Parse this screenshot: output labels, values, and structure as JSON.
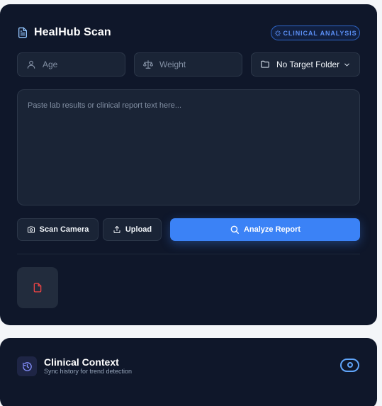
{
  "header": {
    "title": "HealHub Scan",
    "badge": "CLINICAL ANALYSIS"
  },
  "fields": {
    "age": {
      "placeholder": "Age",
      "value": ""
    },
    "weight": {
      "placeholder": "Weight",
      "value": ""
    },
    "folder": {
      "selected": "No Target Folder"
    }
  },
  "report": {
    "placeholder": "Paste lab results or clinical report text here...",
    "value": ""
  },
  "actions": {
    "camera": "Scan Camera",
    "upload": "Upload",
    "analyze": "Analyze Report"
  },
  "context": {
    "title": "Clinical Context",
    "subtitle": "Sync history for trend detection",
    "toggle_on": true
  },
  "icons": {
    "header": "file-text-icon",
    "badge": "sparkle-icon",
    "age": "user-icon",
    "weight": "scale-icon",
    "folder": "folder-icon",
    "folder_chevron": "chevron-down-icon",
    "camera": "camera-icon",
    "upload": "upload-icon",
    "analyze": "search-icon",
    "attachment": "file-icon",
    "context": "history-icon"
  },
  "colors": {
    "card_bg": "#0f172a",
    "accent": "#3b82f6",
    "badge_text": "#5b8ff5",
    "attachment_icon": "#ef4444",
    "toggle": "#60a5fa"
  }
}
